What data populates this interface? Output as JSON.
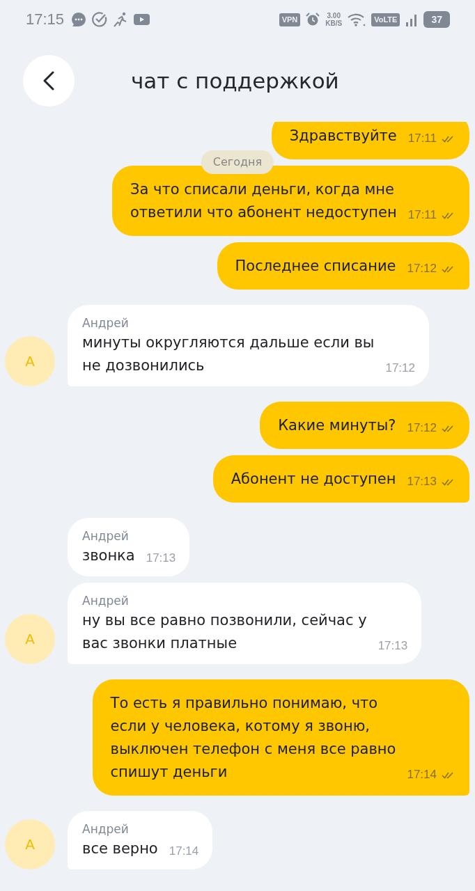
{
  "status_bar": {
    "time": "17:15",
    "vpn": "VPN",
    "speed_value": "3.00",
    "speed_unit": "KB/S",
    "volte": "VoLTE",
    "battery": "37"
  },
  "header": {
    "title": "чат с поддержкой"
  },
  "date_divider": "Сегодня",
  "messages": [
    {
      "kind": "outgoing",
      "text": "Здравствуйте",
      "time": "17:11",
      "read": true
    },
    {
      "kind": "outgoing",
      "text": "За что списали деньги, когда мне\nответили что абонент недоступен",
      "time": "17:11",
      "read": true
    },
    {
      "kind": "outgoing",
      "text": "Последнее списание",
      "time": "17:12",
      "read": true
    },
    {
      "kind": "incoming",
      "sender": "Андрей",
      "avatar": "А",
      "text": "минуты округляются дальше если вы\nне дозвонились",
      "time": "17:12"
    },
    {
      "kind": "outgoing",
      "text": "Какие минуты?",
      "time": "17:12",
      "read": true
    },
    {
      "kind": "outgoing",
      "text": "Абонент не доступен",
      "time": "17:13",
      "read": true
    },
    {
      "kind": "incoming",
      "sender": "Андрей",
      "text": "звонка",
      "time": "17:13"
    },
    {
      "kind": "incoming",
      "sender": "Андрей",
      "avatar": "А",
      "text": "ну вы все равно позвонили, сейчас у\nвас звонки платные",
      "time": "17:13"
    },
    {
      "kind": "outgoing",
      "text": "То есть я правильно понимаю, что\nесли у человека, котому я звоню,\nвыключен телефон с меня все равно\nспишут деньги",
      "time": "17:14",
      "read": true
    },
    {
      "kind": "incoming",
      "sender": "Андрей",
      "avatar": "А",
      "text": "все верно",
      "time": "17:14"
    }
  ]
}
